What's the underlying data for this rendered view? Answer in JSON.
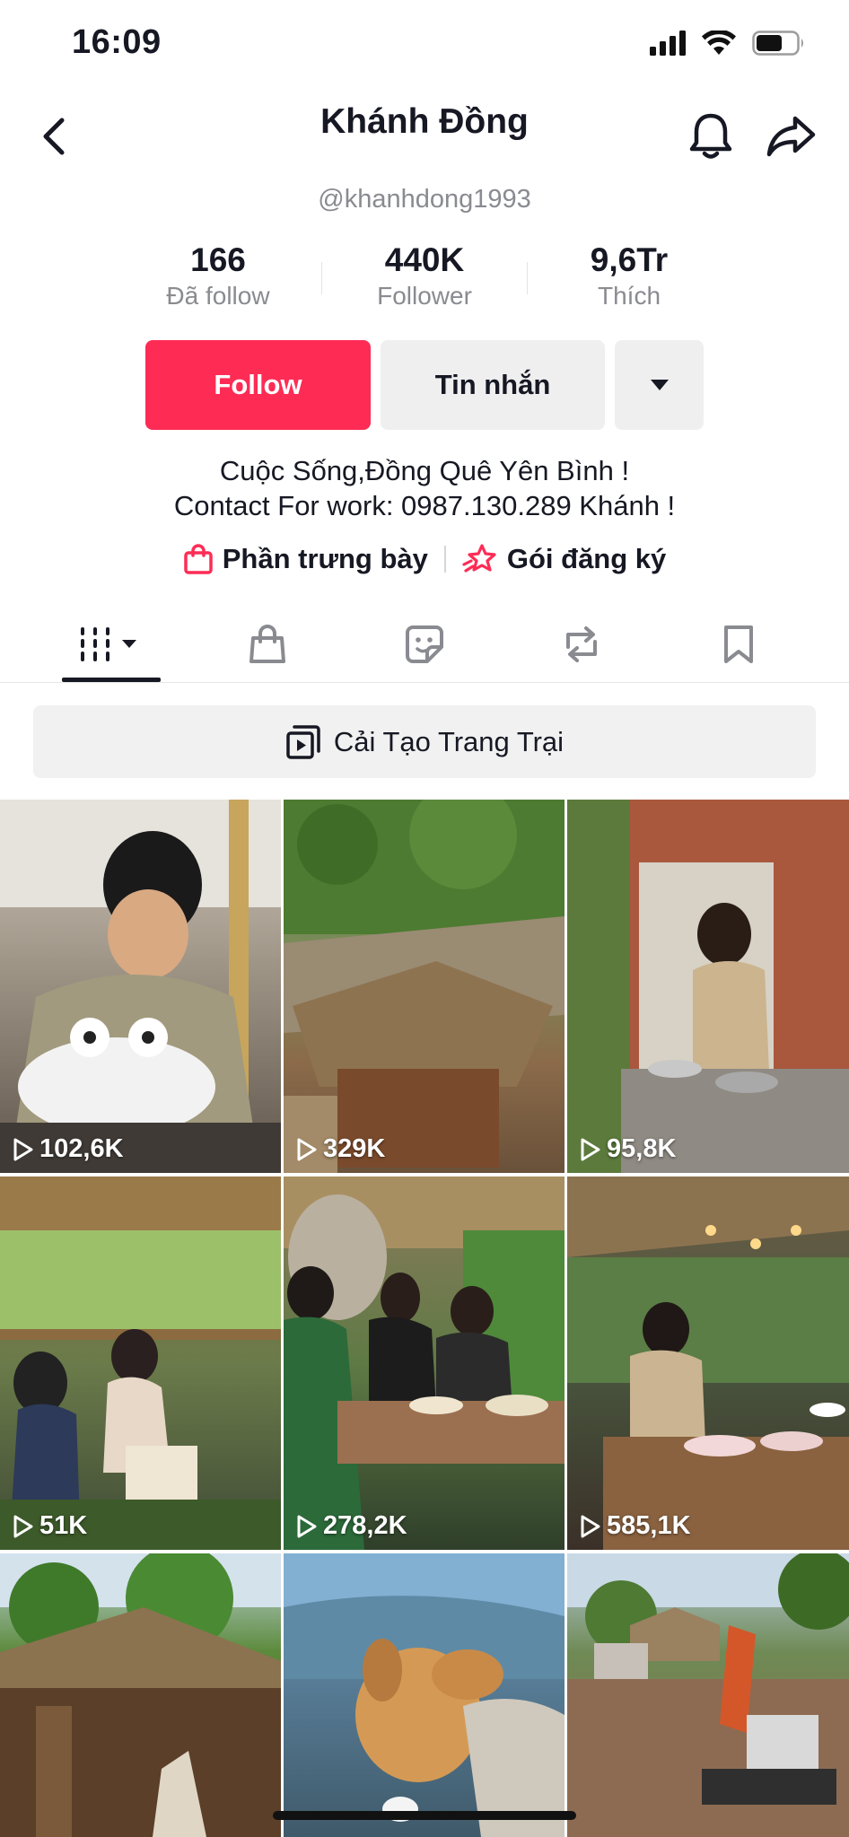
{
  "status_bar": {
    "time": "16:09",
    "battery_level": 0.65
  },
  "header": {
    "title": "Khánh Đồng",
    "handle": "@khanhdong1993"
  },
  "stats": [
    {
      "value": "166",
      "label": "Đã follow"
    },
    {
      "value": "440K",
      "label": "Follower"
    },
    {
      "value": "9,6Tr",
      "label": "Thích"
    }
  ],
  "actions": {
    "follow_label": "Follow",
    "message_label": "Tin nhắn"
  },
  "bio": {
    "line1": "Cuộc Sống,Đồng Quê Yên Bình !",
    "line2": "Contact For work: 0987.130.289 Khánh !"
  },
  "links": {
    "showcase_label": "Phần trưng bày",
    "subscription_label": "Gói đăng ký"
  },
  "tabs": [
    "videos-grid-icon",
    "shopping-bag-icon",
    "sticker-icon",
    "repost-icon",
    "bookmark-icon"
  ],
  "playlist": {
    "label": "Cải Tạo Trang Trại"
  },
  "videos": [
    {
      "views": "102,6K",
      "scene": "man decorating white frog cake"
    },
    {
      "views": "329K",
      "scene": "thatched roof house on hillside"
    },
    {
      "views": "95,8K",
      "scene": "man cooking in brick kitchen"
    },
    {
      "views": "51K",
      "scene": "family meal under bamboo pavilion"
    },
    {
      "views": "278,2K",
      "scene": "people eating at wooden table"
    },
    {
      "views": "585,1K",
      "scene": "man preparing food at outdoor table"
    },
    {
      "views": "",
      "scene": "thatched hut with trees"
    },
    {
      "views": "",
      "scene": "golden retriever dog"
    },
    {
      "views": "",
      "scene": "excavator at construction site"
    }
  ],
  "colors": {
    "accent": "#fe2c55",
    "text": "#161823",
    "muted": "#8a8b91",
    "button_bg": "#efeff0"
  }
}
